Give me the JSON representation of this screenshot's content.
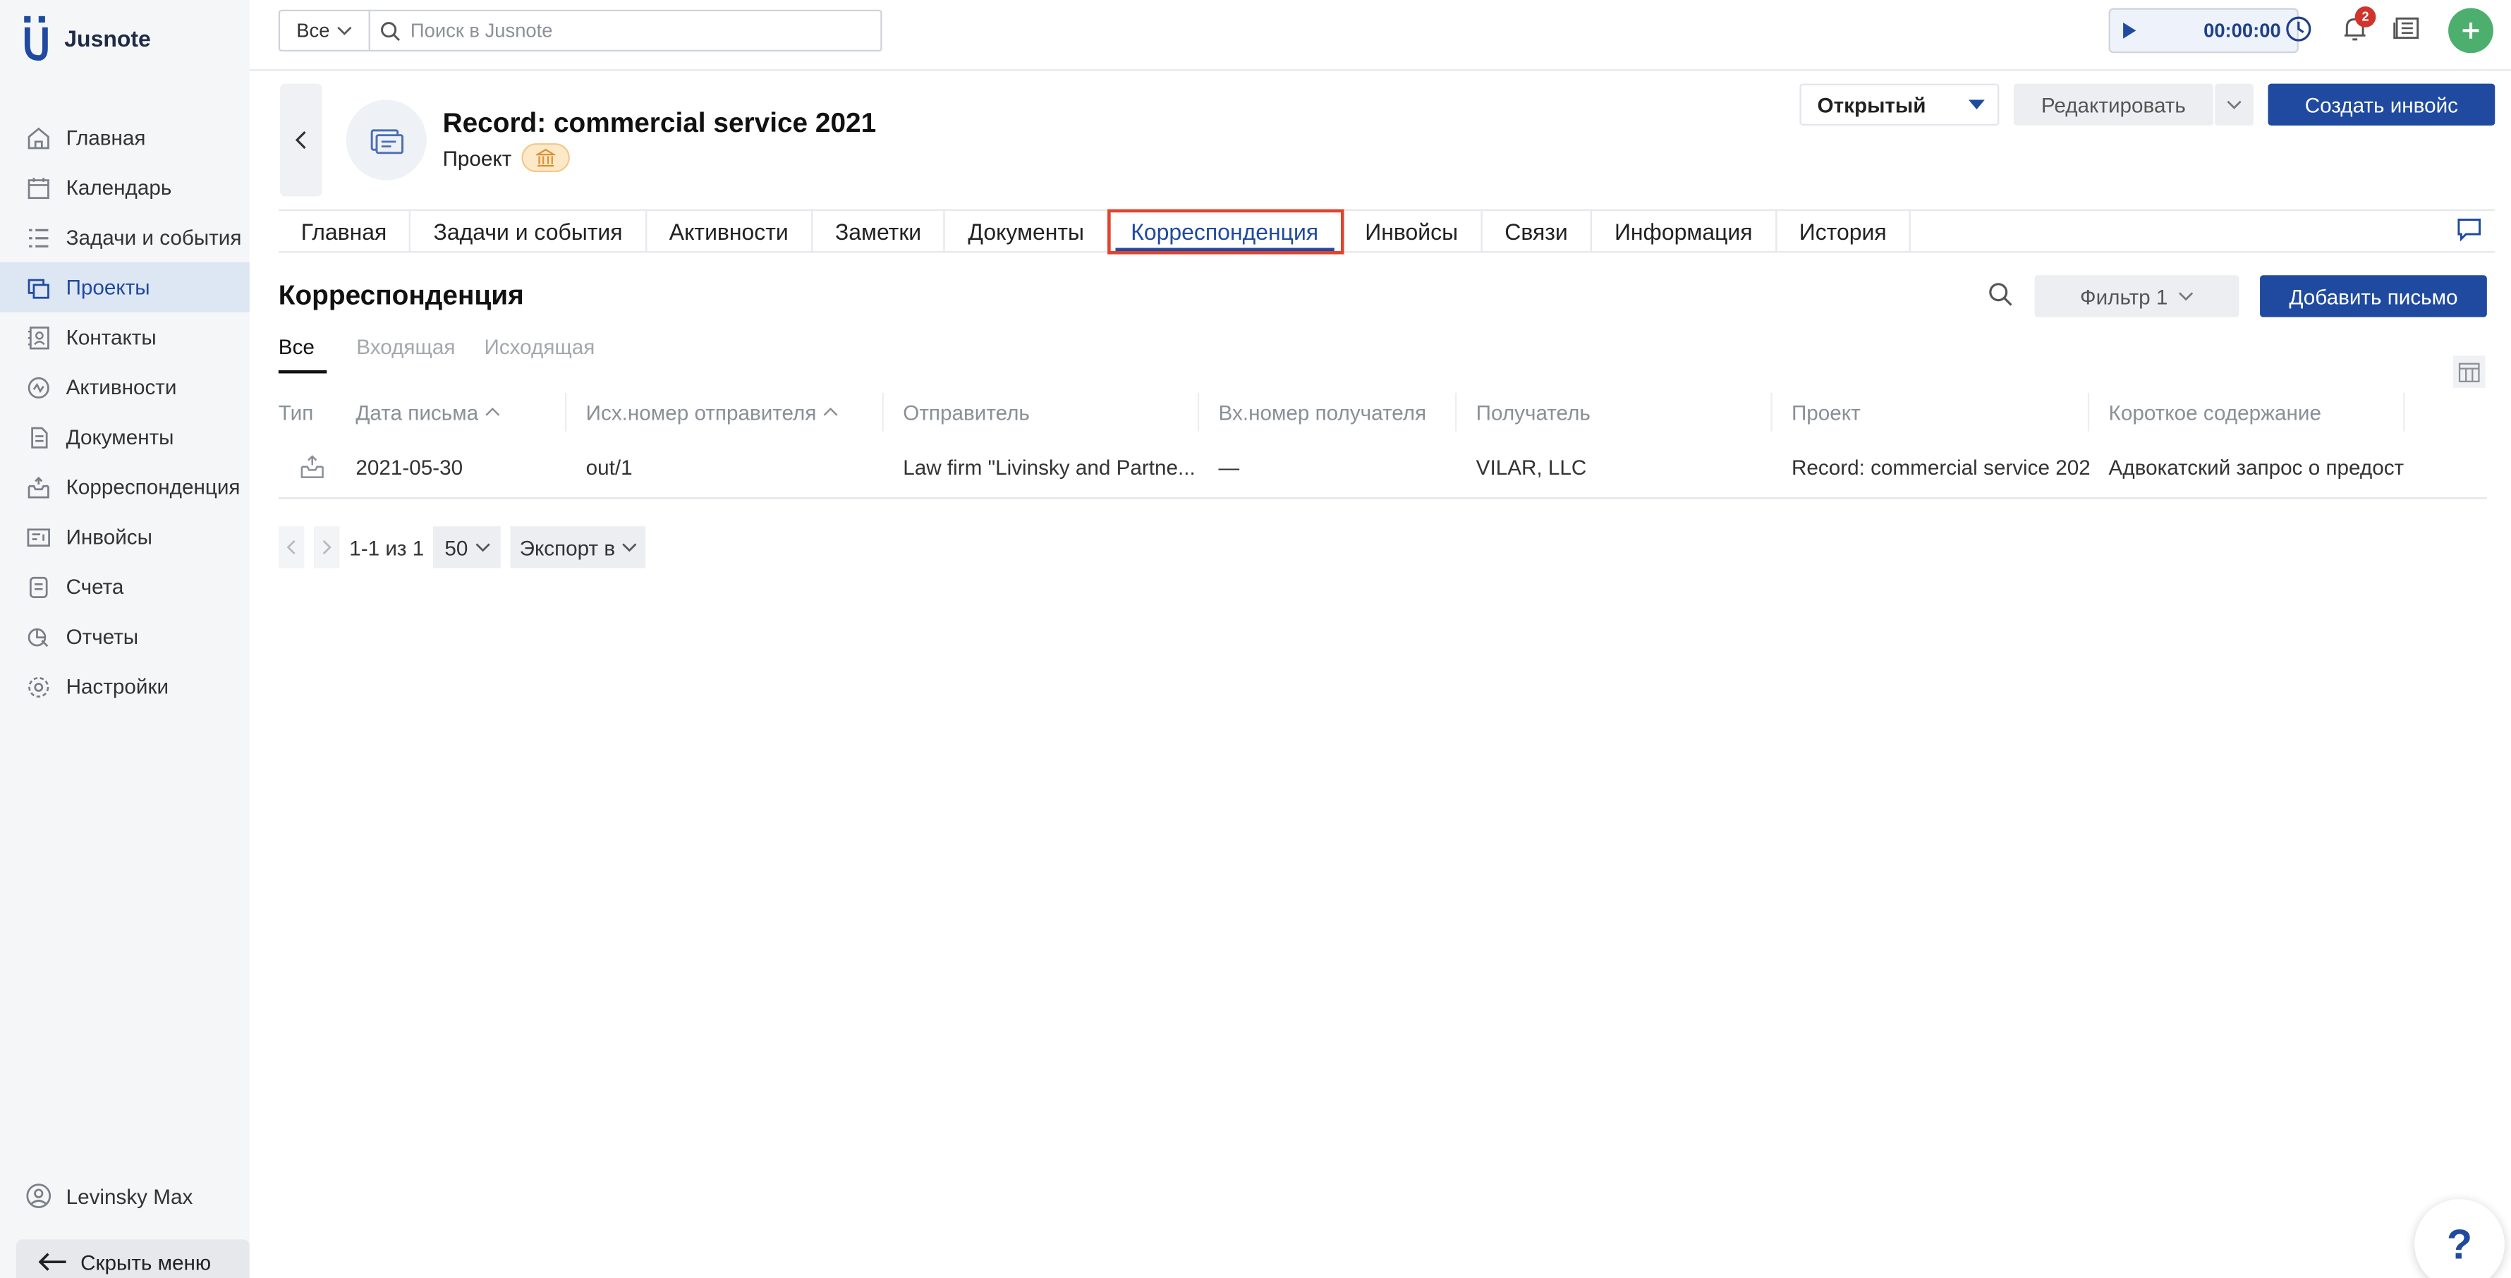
{
  "app": {
    "name": "Jusnote"
  },
  "sidebar": {
    "items": [
      {
        "label": "Главная",
        "icon": "home-icon"
      },
      {
        "label": "Календарь",
        "icon": "calendar-icon"
      },
      {
        "label": "Задачи и события",
        "icon": "tasks-icon"
      },
      {
        "label": "Проекты",
        "icon": "folder-icon",
        "active": true
      },
      {
        "label": "Контакты",
        "icon": "contacts-icon"
      },
      {
        "label": "Активности",
        "icon": "activity-icon"
      },
      {
        "label": "Документы",
        "icon": "documents-icon"
      },
      {
        "label": "Корреспонденция",
        "icon": "mail-icon"
      },
      {
        "label": "Инвойсы",
        "icon": "invoice-icon"
      },
      {
        "label": "Счета",
        "icon": "bills-icon"
      },
      {
        "label": "Отчеты",
        "icon": "reports-icon"
      },
      {
        "label": "Настройки",
        "icon": "settings-icon"
      }
    ],
    "user": "Levinsky Max",
    "hide_menu": "Скрыть меню"
  },
  "topbar": {
    "search_scope": "Все",
    "search_placeholder": "Поиск в Jusnote",
    "timer": "00:00:00",
    "notifications_count": "2"
  },
  "header": {
    "title": "Record: commercial service 2021",
    "subtitle": "Проект",
    "status": "Открытый",
    "edit_label": "Редактировать",
    "create_invoice_label": "Создать инвойс"
  },
  "tabs": [
    "Главная",
    "Задачи и события",
    "Активности",
    "Заметки",
    "Документы",
    "Корреспонденция",
    "Инвойсы",
    "Связи",
    "Информация",
    "История"
  ],
  "active_tab": "Корреспонденция",
  "section": {
    "title": "Корреспонденция",
    "filter_label": "Фильтр 1",
    "add_label": "Добавить письмо",
    "subtabs": [
      "Все",
      "Входящая",
      "Исходящая"
    ]
  },
  "table": {
    "columns": [
      "Тип",
      "Дата письма",
      "Исх.номер отправителя",
      "Отправитель",
      "Вх.номер получателя",
      "Получатель",
      "Проект",
      "Короткое содержание"
    ],
    "rows": [
      {
        "type_icon": "outgoing-mail-icon",
        "date": "2021-05-30",
        "sender_number": "out/1",
        "sender": "Law firm \"Livinsky and Partne...",
        "recipient_number": "—",
        "recipient": "VILAR, LLC",
        "project": "Record: commercial service 202",
        "summary": "Адвокатский запрос о предост"
      }
    ]
  },
  "pagination": {
    "range": "1-1 из 1",
    "page_size": "50",
    "export_label": "Экспорт в"
  },
  "colors": {
    "primary": "#1f4aa0",
    "highlight_box": "#e0432e",
    "add_button": "#4caf6e",
    "badge": "#d0342c"
  }
}
